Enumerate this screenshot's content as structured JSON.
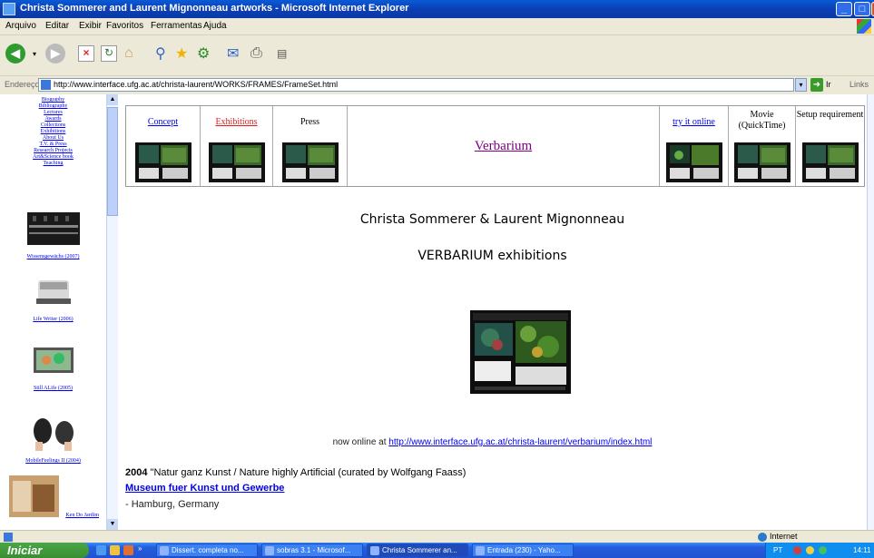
{
  "window": {
    "title": "Christa Sommerer and Laurent Mignonneau artworks - Microsoft Internet Explorer",
    "buttons": [
      "_",
      "□",
      "X"
    ]
  },
  "menu": [
    "Arquivo",
    "Editar",
    "Exibir",
    "Favoritos",
    "Ferramentas",
    "Ajuda"
  ],
  "toolbar_icons": [
    "back-icon",
    "forward-icon",
    "stop-icon",
    "refresh-icon",
    "home-icon",
    "search-icon",
    "favorites-icon",
    "history-icon",
    "mail-icon",
    "print-icon",
    "edit-icon"
  ],
  "address": {
    "label": "Endereço",
    "url": "http://www.interface.ufg.ac.at/christa-laurent/WORKS/FRAMES/FrameSet.html",
    "go_label": "Ir",
    "links_label": "Links"
  },
  "left_nav": {
    "links": [
      "Biography",
      "Bibliography",
      "Lectures",
      "Awards",
      "Collections",
      "Exhibitions",
      "About Us",
      "T.V. & Press",
      "Research Projects",
      "Art&Science book",
      "Teaching"
    ],
    "works": [
      {
        "caption": "Wissensgewächs (2007)"
      },
      {
        "caption": "Life Writer (2006)"
      },
      {
        "caption": "Still ALife (2005)"
      },
      {
        "caption": "MobileFeelings II (2004)"
      },
      {
        "caption": "Ken Do Jardim"
      }
    ]
  },
  "nav_table": {
    "cells": [
      {
        "label": "Concept",
        "style": "link"
      },
      {
        "label": "Exhibitions",
        "style": "active"
      },
      {
        "label": "Press",
        "style": "plain"
      },
      {
        "label": "try it online",
        "style": "link"
      },
      {
        "label": "Movie (QuickTime)",
        "style": "plain"
      },
      {
        "label": "Setup requirement",
        "style": "plain"
      }
    ],
    "title": "Verbarium"
  },
  "main": {
    "heading1": "Christa Sommerer & Laurent Mignonneau",
    "heading2": "VERBARIUM exhibitions",
    "online_prefix": "now online at ",
    "online_url": "http://www.interface.ufg.ac.at/christa-laurent/verbarium/index.html",
    "exhibitions": [
      {
        "year": "2004",
        "title": " \"Natur ganz Kunst / Nature highly Artificial (curated by Wolfgang Faass)",
        "venue": "Museum fuer Kunst und Gewerbe",
        "location": "- Hamburg, Germany"
      }
    ]
  },
  "status": {
    "zone": "Internet"
  },
  "taskbar": {
    "start_label": "Iniciar",
    "tasks": [
      {
        "label": "Dissert. completa no..."
      },
      {
        "label": "sobras 3.1 - Microsof..."
      },
      {
        "label": "Christa Sommerer an..."
      },
      {
        "label": "Entrada (230) - Yaho..."
      }
    ],
    "language": "PT",
    "clock": "14:11"
  },
  "colors": {
    "link": "#0000ee",
    "visited": "#800080",
    "active_link": "#e02020",
    "titlebar": "#0b3fb4",
    "taskbar": "#245ede",
    "start": "#378f31"
  }
}
